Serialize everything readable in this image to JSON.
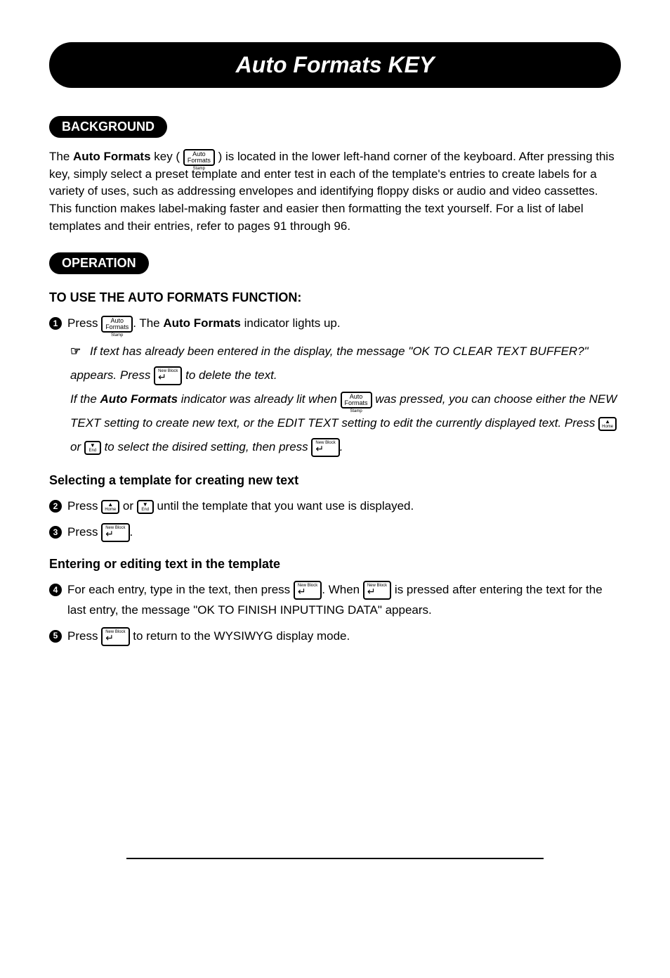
{
  "title": "Auto Formats KEY",
  "sections": {
    "background": {
      "label": "BACKGROUND",
      "text_pre": "The ",
      "text_bold1": "Auto Formats",
      "text_mid1": " key ( ",
      "key_auto": "Auto\nFormats",
      "text_mid2": " ) is located in the lower left-hand corner of the keyboard.  After pressing this key, simply select a preset template and enter test in each of the template's entries to create labels for a variety of uses, such as addressing envelopes and identifying floppy disks or audio and video cassettes. This function makes label-making faster and easier then formatting the text yourself.  For a list of label templates and their entries, refer to pages 91 through 96."
    },
    "operation": {
      "label": "OPERATION",
      "heading": "TO USE THE AUTO FORMATS FUNCTION:",
      "step1_a": "Press ",
      "step1_b": ". The ",
      "step1_bold": "Auto Formats",
      "step1_c": " indicator lights up.",
      "note_icon": "☞",
      "note1_a": "If text has already been entered in the display, the message \"OK TO CLEAR TEXT BUFFER?\" appears.  Press ",
      "note1_b": " to delete the text.",
      "note2_a": "If the ",
      "note2_bold": "Auto Formats",
      "note2_b": " indicator was already lit when ",
      "note2_c": " was pressed, you can choose either the NEW TEXT setting to create new text, or the EDIT TEXT setting to edit the currently displayed text.  Press ",
      "note2_d": " or ",
      "note2_e": " to select the disired setting, then press ",
      "note2_f": ".",
      "sub1_title": "Selecting a template for creating new text",
      "step2_a": "Press ",
      "step2_b": " or ",
      "step2_c": " until the template that you want use is displayed.",
      "step3_a": "Press ",
      "step3_b": ".",
      "sub2_title": "Entering or editing text in the template",
      "step4_a": "For each entry, type in the text, then press ",
      "step4_b": ". When ",
      "step4_c": " is pressed after entering the text for the last entry, the message \"OK TO FINISH INPUTTING DATA\" appears.",
      "step5_a": "Press ",
      "step5_b": " to return to the WYSIWYG display mode."
    }
  },
  "keys": {
    "auto_formats_top": "Auto",
    "auto_formats_bot": "Formats",
    "new_block": "New Block",
    "enter_sym": "↵",
    "home_tri": "▲",
    "home_sub": "Home",
    "end_tri": "▼",
    "end_sub": "End"
  }
}
